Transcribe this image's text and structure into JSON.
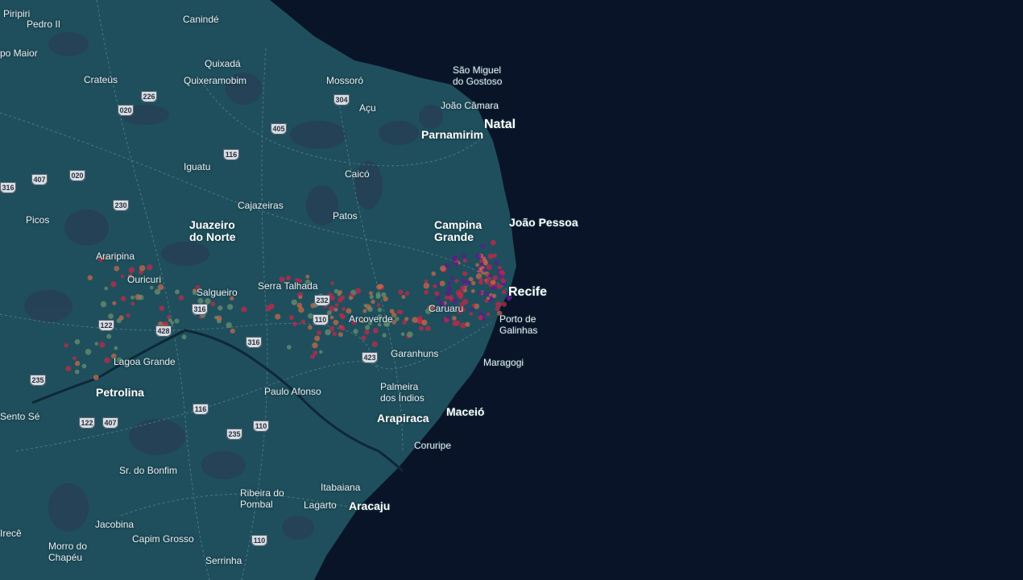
{
  "colors": {
    "ocean": "#0a1429",
    "land": "#1f4f5c",
    "land_dark": "#273f55",
    "road": "#6f9aa4",
    "heat_low": "#6b8f6e",
    "heat_mid": "#c46a4a",
    "heat_high": "#c2284a",
    "heat_max": "#5a1d8c"
  },
  "places": [
    {
      "name": "Piripiri",
      "kind": "city"
    },
    {
      "name": "Pedro II",
      "kind": "city"
    },
    {
      "name": "Canindé",
      "kind": "city"
    },
    {
      "name": "po Maior",
      "kind": "city"
    },
    {
      "name": "Quixadá",
      "kind": "city"
    },
    {
      "name": "Crateús",
      "kind": "city"
    },
    {
      "name": "Quixeramobim",
      "kind": "city"
    },
    {
      "name": "Mossoró",
      "kind": "city"
    },
    {
      "name": "São Miguel",
      "kind": "city"
    },
    {
      "name": "do Gostoso",
      "kind": "city"
    },
    {
      "name": "Açu",
      "kind": "city"
    },
    {
      "name": "João Câmara",
      "kind": "city"
    },
    {
      "name": "Natal",
      "kind": "capital"
    },
    {
      "name": "Parnamirim",
      "kind": "major"
    },
    {
      "name": "Iguatu",
      "kind": "city"
    },
    {
      "name": "Caicó",
      "kind": "city"
    },
    {
      "name": "Cajazeiras",
      "kind": "city"
    },
    {
      "name": "Picos",
      "kind": "city"
    },
    {
      "name": "Juazeiro",
      "kind": "major"
    },
    {
      "name": "do Norte",
      "kind": "major"
    },
    {
      "name": "Patos",
      "kind": "city"
    },
    {
      "name": "Campina",
      "kind": "major"
    },
    {
      "name": "Grande",
      "kind": "major"
    },
    {
      "name": "João Pessoa",
      "kind": "major"
    },
    {
      "name": "Araripina",
      "kind": "city"
    },
    {
      "name": "Ouricuri",
      "kind": "city"
    },
    {
      "name": "Salgueiro",
      "kind": "city"
    },
    {
      "name": "Serra Talhada",
      "kind": "city"
    },
    {
      "name": "Recife",
      "kind": "capital"
    },
    {
      "name": "Caruaru",
      "kind": "city"
    },
    {
      "name": "Arcoverde",
      "kind": "city"
    },
    {
      "name": "Porto de",
      "kind": "city"
    },
    {
      "name": "Galinhas",
      "kind": "city"
    },
    {
      "name": "Lagoa Grande",
      "kind": "city"
    },
    {
      "name": "Garanhuns",
      "kind": "city"
    },
    {
      "name": "Maragogi",
      "kind": "city"
    },
    {
      "name": "Petrolina",
      "kind": "major"
    },
    {
      "name": "Paulo Afonso",
      "kind": "city"
    },
    {
      "name": "Palmeira",
      "kind": "city"
    },
    {
      "name": "dos Índios",
      "kind": "city"
    },
    {
      "name": "Sento Sé",
      "kind": "city"
    },
    {
      "name": "Arapiraca",
      "kind": "major"
    },
    {
      "name": "Maceió",
      "kind": "major"
    },
    {
      "name": "Coruripe",
      "kind": "city"
    },
    {
      "name": "Sr. do Bonfim",
      "kind": "city"
    },
    {
      "name": "Itabaiana",
      "kind": "city"
    },
    {
      "name": "Ribeira do",
      "kind": "city"
    },
    {
      "name": "Pombal",
      "kind": "city"
    },
    {
      "name": "Lagarto",
      "kind": "city"
    },
    {
      "name": "Aracaju",
      "kind": "major"
    },
    {
      "name": "Jacobina",
      "kind": "city"
    },
    {
      "name": "Irecê",
      "kind": "city"
    },
    {
      "name": "Capim Grosso",
      "kind": "city"
    },
    {
      "name": "Morro do",
      "kind": "city"
    },
    {
      "name": "Chapéu",
      "kind": "city"
    },
    {
      "name": "Serrinha",
      "kind": "city"
    }
  ],
  "shields": [
    "020",
    "226",
    "304",
    "405",
    "116",
    "407",
    "020",
    "316",
    "230",
    "316",
    "232",
    "110",
    "122",
    "428",
    "316",
    "423",
    "235",
    "116",
    "122",
    "407",
    "110",
    "235",
    "110"
  ]
}
